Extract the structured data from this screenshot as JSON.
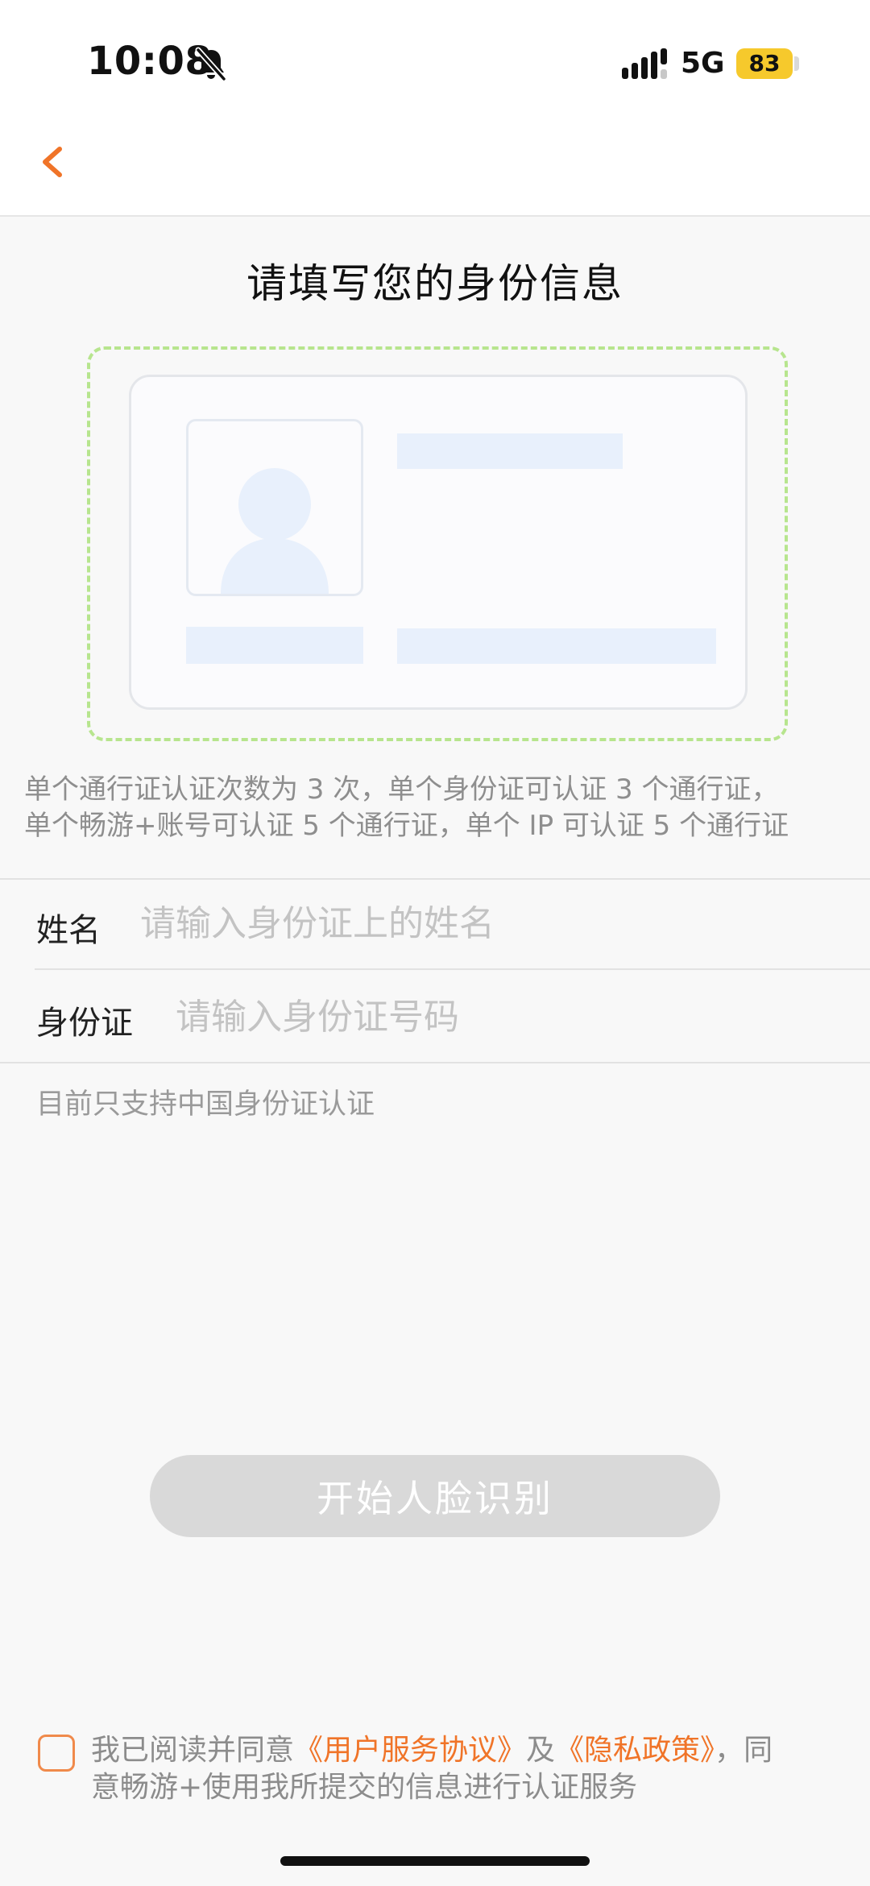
{
  "status_bar": {
    "time": "10:08",
    "network": "5G",
    "battery": "83",
    "battery_color": "#f6c92c"
  },
  "title": "请填写您的身份信息",
  "notice": {
    "line1": "单个通行证认证次数为 3 次，单个身份证可认证 3 个通行证，",
    "line2": "单个畅游+账号可认证 5 个通行证，单个 IP 可认证 5 个通行证"
  },
  "form": {
    "name_label": "姓名",
    "name_placeholder": "请输入身份证上的姓名",
    "id_label": "身份证",
    "id_placeholder": "请输入身份证号码"
  },
  "support_note": "目前只支持中国身份证认证",
  "start_button": "开始人脸识别",
  "agreement": {
    "prefix": "我已阅读并同意",
    "user_agreement": "《用户服务协议》",
    "and": "及",
    "privacy_policy": "《隐私政策》",
    "suffix_line1": "，同",
    "line2": "意畅游+使用我所提交的信息进行认证服务"
  },
  "colors": {
    "accent": "#f07428",
    "frame_dashed": "#b7e58e",
    "button_disabled": "#d9d9d9"
  },
  "icons": {
    "back": "chevron-left-icon",
    "mute": "bell-slash-icon",
    "signal": "signal-icon",
    "placeholder_avatar": "person-icon"
  }
}
